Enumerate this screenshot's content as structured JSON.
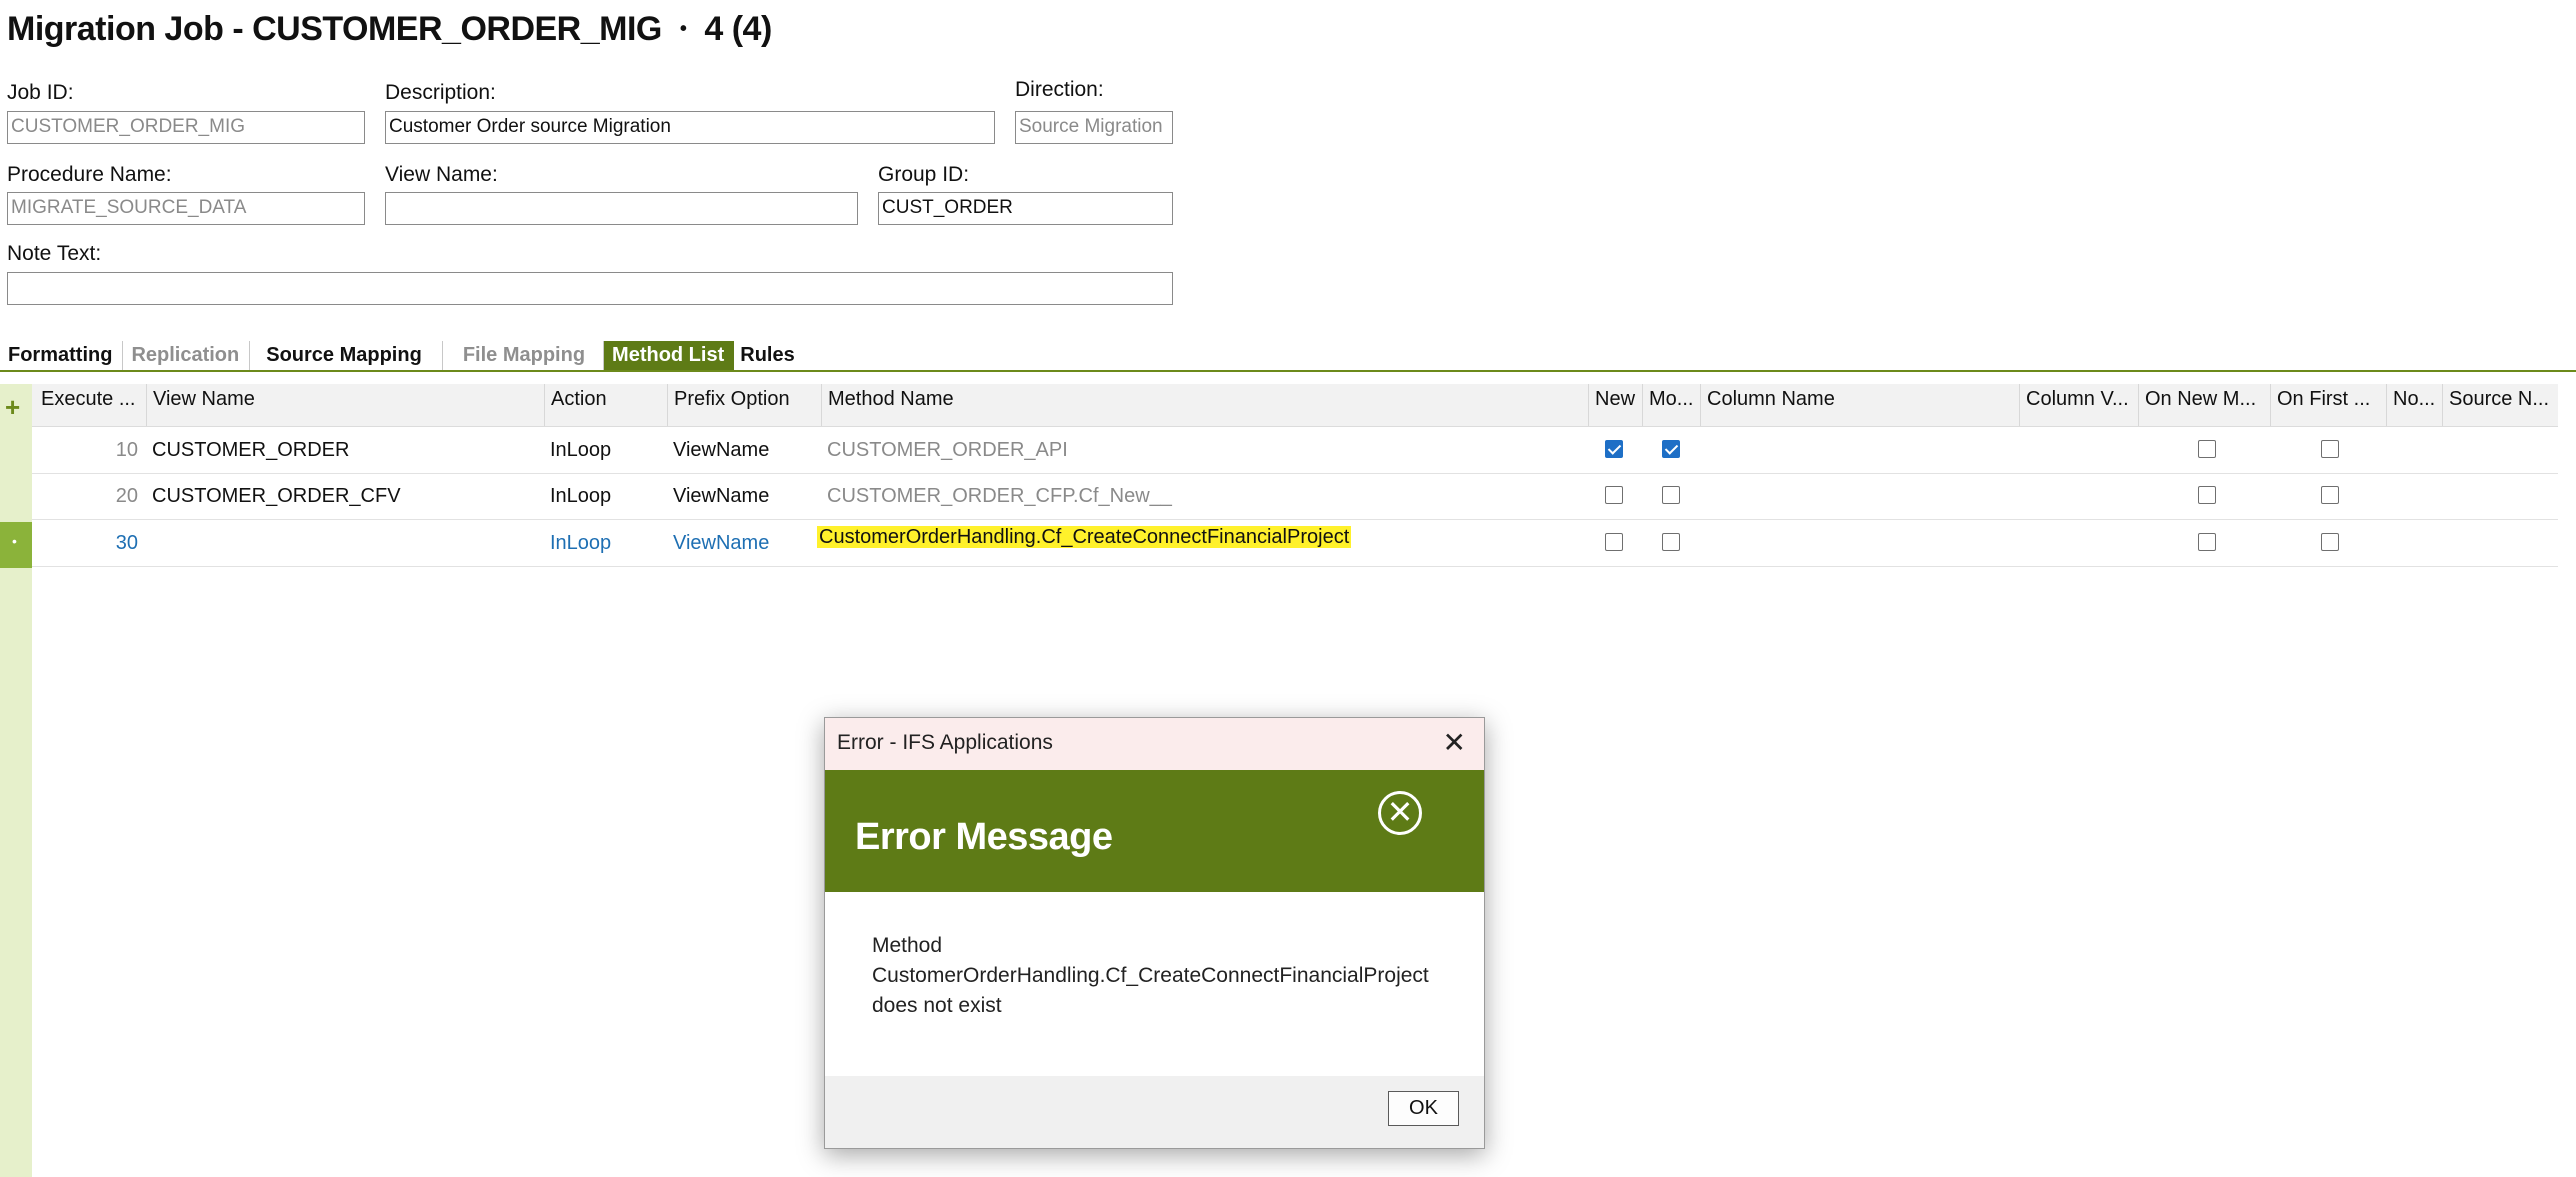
{
  "header": {
    "title": "Migration Job - CUSTOMER_ORDER_MIG",
    "separator": "•",
    "record_count": "4 (4)"
  },
  "form": {
    "job_id": {
      "label": "Job ID:",
      "value": "CUSTOMER_ORDER_MIG"
    },
    "description": {
      "label": "Description:",
      "value": "Customer Order source Migration"
    },
    "direction": {
      "label": "Direction:",
      "value": "Source Migration"
    },
    "procedure_name": {
      "label": "Procedure Name:",
      "value": "MIGRATE_SOURCE_DATA"
    },
    "view_name": {
      "label": "View Name:",
      "value": ""
    },
    "group_id": {
      "label": "Group ID:",
      "value": "CUST_ORDER"
    },
    "note_text": {
      "label": "Note Text:",
      "value": ""
    }
  },
  "tabs": [
    {
      "label": "Formatting",
      "state": "enabled"
    },
    {
      "label": "Replication",
      "state": "disabled"
    },
    {
      "label": "Source Mapping",
      "state": "enabled"
    },
    {
      "label": "File Mapping",
      "state": "disabled"
    },
    {
      "label": "Method List",
      "state": "active"
    },
    {
      "label": "Rules",
      "state": "enabled"
    }
  ],
  "grid": {
    "add_icon": "plus-icon",
    "columns": [
      "Execute ...",
      "View Name",
      "Action",
      "Prefix Option",
      "Method Name",
      "New",
      "Mo...",
      "Column Name",
      "Column V...",
      "On New M...",
      "On First ...",
      "No...",
      "Source N..."
    ],
    "rows": [
      {
        "execute": "10",
        "view_name": "CUSTOMER_ORDER",
        "action": "InLoop",
        "prefix_option": "ViewName",
        "method_name": "CUSTOMER_ORDER_API",
        "new": true,
        "modify": true,
        "on_new": false,
        "on_first": false
      },
      {
        "execute": "20",
        "view_name": "CUSTOMER_ORDER_CFV",
        "action": "InLoop",
        "prefix_option": "ViewName",
        "method_name": "CUSTOMER_ORDER_CFP.Cf_New__",
        "new": false,
        "modify": false,
        "on_new": false,
        "on_first": false
      },
      {
        "execute": "30",
        "view_name": "",
        "action": "InLoop",
        "prefix_option": "ViewName",
        "method_name": "CustomerOrderHandling.Cf_CreateConnectFinancialProject",
        "new": false,
        "modify": false,
        "on_new": false,
        "on_first": false
      }
    ]
  },
  "dialog": {
    "window_title": "Error - IFS Applications",
    "heading": "Error Message",
    "message_lines": [
      "Method",
      "CustomerOrderHandling.Cf_CreateConnectFinancialProject",
      "does not exist"
    ],
    "ok_label": "OK",
    "close_glyph": "✕",
    "error_glyph": "✕"
  },
  "colors": {
    "accent_green": "#5e7b16",
    "gutter_green": "#e6f0cb",
    "link_blue": "#1e6fb3",
    "highlight": "#fff12b"
  }
}
